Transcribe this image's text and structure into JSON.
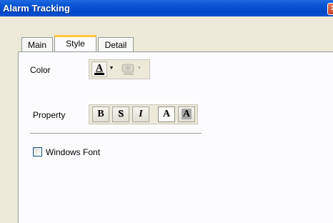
{
  "window": {
    "title": "Alarm Tracking",
    "close_glyph": "✕"
  },
  "tabs": [
    {
      "label": "Main",
      "active": false
    },
    {
      "label": "Style",
      "active": true
    },
    {
      "label": "Detail",
      "active": false
    }
  ],
  "style_tab": {
    "color_label": "Color",
    "foreground_color_letter": "A",
    "property_label": "Property",
    "property_buttons": [
      {
        "name": "bold",
        "glyph": "B",
        "pressed": false
      },
      {
        "name": "shadow",
        "glyph": "S",
        "pressed": false
      },
      {
        "name": "italic",
        "glyph": "I",
        "pressed": false
      },
      {
        "name": "normal",
        "glyph": "A",
        "pressed": true
      },
      {
        "name": "outline",
        "glyph": "A",
        "pressed": false
      }
    ],
    "windows_font_label": "Windows Font",
    "windows_font_checked": false
  }
}
